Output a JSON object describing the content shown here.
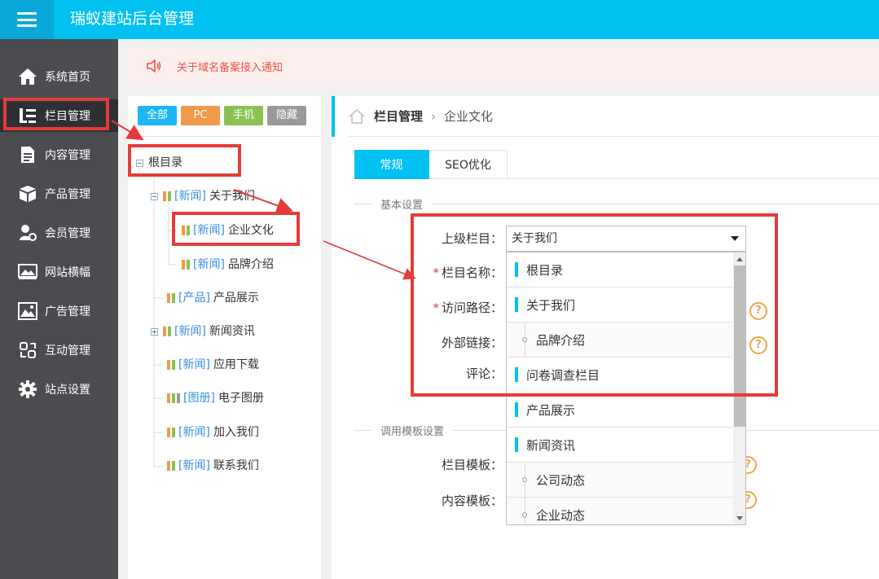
{
  "app": {
    "title": "瑞蚁建站后台管理"
  },
  "sidebar": {
    "items": [
      {
        "label": "系统首页",
        "icon": "home-icon"
      },
      {
        "label": "栏目管理",
        "icon": "list-tree-icon",
        "active": true
      },
      {
        "label": "内容管理",
        "icon": "document-icon"
      },
      {
        "label": "产品管理",
        "icon": "box-icon"
      },
      {
        "label": "会员管理",
        "icon": "member-icon"
      },
      {
        "label": "网站横幅",
        "icon": "banner-image-icon"
      },
      {
        "label": "广告管理",
        "icon": "ad-image-icon"
      },
      {
        "label": "互动管理",
        "icon": "interaction-icon"
      },
      {
        "label": "站点设置",
        "icon": "gear-icon"
      }
    ]
  },
  "notice": {
    "text": "关于域名备案接入通知"
  },
  "filters": [
    {
      "label": "全部",
      "color": "#1db6f2"
    },
    {
      "label": "PC",
      "color": "#f09a4b"
    },
    {
      "label": "手机",
      "color": "#8cc152"
    },
    {
      "label": "隐藏",
      "color": "#9a9a9a"
    }
  ],
  "tree": {
    "root": "根目录",
    "nodes": [
      {
        "tag": "[新闻]",
        "label": "关于我们"
      },
      {
        "tag": "[新闻]",
        "label": "企业文化"
      },
      {
        "tag": "[新闻]",
        "label": "品牌介绍"
      },
      {
        "tag": "[产品]",
        "label": "产品展示"
      },
      {
        "tag": "[新闻]",
        "label": "新闻资讯"
      },
      {
        "tag": "[新闻]",
        "label": "应用下载"
      },
      {
        "tag": "[图册]",
        "label": "电子图册"
      },
      {
        "tag": "[新闻]",
        "label": "加入我们"
      },
      {
        "tag": "[新闻]",
        "label": "联系我们"
      }
    ]
  },
  "breadcrumb": {
    "section": "栏目管理",
    "current": "企业文化"
  },
  "tabs": [
    {
      "label": "常规"
    },
    {
      "label": "SEO优化"
    }
  ],
  "form": {
    "basic_title": "基本设置",
    "template_title": "调用模板设置",
    "labels": {
      "parent": "上级栏目：",
      "name": "栏目名称：",
      "path": "访问路径：",
      "external": "外部链接：",
      "comment": "评论：",
      "column_template": "栏目模板：",
      "content_template": "内容模板："
    },
    "required_mark": "*",
    "help_mark": "?",
    "parent_value": "关于我们"
  },
  "dropdown": {
    "options": [
      {
        "label": "根目录",
        "level": 0
      },
      {
        "label": "关于我们",
        "level": 0
      },
      {
        "label": "品牌介绍",
        "level": 1
      },
      {
        "label": "问卷调查栏目",
        "level": 0
      },
      {
        "label": "产品展示",
        "level": 0
      },
      {
        "label": "新闻资讯",
        "level": 0
      },
      {
        "label": "公司动态",
        "level": 1
      },
      {
        "label": "企业动态",
        "level": 1
      }
    ]
  },
  "colors": {
    "accent": "#00c1f2",
    "annotation": "#e63b3b",
    "help": "#f0a54a",
    "tag_blue": "#3a8ee6"
  }
}
